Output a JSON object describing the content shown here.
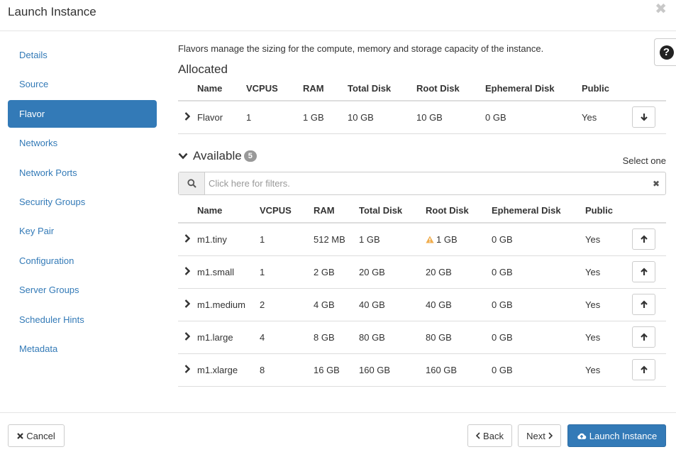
{
  "header": {
    "title": "Launch Instance",
    "close_icon": "close-icon"
  },
  "sidebar": {
    "items": [
      {
        "label": "Details",
        "active": false
      },
      {
        "label": "Source",
        "active": false
      },
      {
        "label": "Flavor",
        "active": true
      },
      {
        "label": "Networks",
        "active": false
      },
      {
        "label": "Network Ports",
        "active": false
      },
      {
        "label": "Security Groups",
        "active": false
      },
      {
        "label": "Key Pair",
        "active": false
      },
      {
        "label": "Configuration",
        "active": false
      },
      {
        "label": "Server Groups",
        "active": false
      },
      {
        "label": "Scheduler Hints",
        "active": false
      },
      {
        "label": "Metadata",
        "active": false
      }
    ]
  },
  "main": {
    "intro": "Flavors manage the sizing for the compute, memory and storage capacity of the instance.",
    "allocated": {
      "title": "Allocated",
      "columns": [
        "Name",
        "VCPUS",
        "RAM",
        "Total Disk",
        "Root Disk",
        "Ephemeral Disk",
        "Public"
      ],
      "rows": [
        {
          "name": "Flavor",
          "vcpus": "1",
          "ram": "1 GB",
          "total_disk": "10 GB",
          "root_disk": "10 GB",
          "ephemeral_disk": "0 GB",
          "public": "Yes"
        }
      ]
    },
    "available": {
      "title": "Available",
      "count": "5",
      "select_hint": "Select one",
      "filter_placeholder": "Click here for filters.",
      "columns": [
        "Name",
        "VCPUS",
        "RAM",
        "Total Disk",
        "Root Disk",
        "Ephemeral Disk",
        "Public"
      ],
      "rows": [
        {
          "name": "m1.tiny",
          "vcpus": "1",
          "ram": "512 MB",
          "total_disk": "1 GB",
          "root_disk": "1 GB",
          "root_warning": true,
          "ephemeral_disk": "0 GB",
          "public": "Yes"
        },
        {
          "name": "m1.small",
          "vcpus": "1",
          "ram": "2 GB",
          "total_disk": "20 GB",
          "root_disk": "20 GB",
          "root_warning": false,
          "ephemeral_disk": "0 GB",
          "public": "Yes"
        },
        {
          "name": "m1.medium",
          "vcpus": "2",
          "ram": "4 GB",
          "total_disk": "40 GB",
          "root_disk": "40 GB",
          "root_warning": false,
          "ephemeral_disk": "0 GB",
          "public": "Yes"
        },
        {
          "name": "m1.large",
          "vcpus": "4",
          "ram": "8 GB",
          "total_disk": "80 GB",
          "root_disk": "80 GB",
          "root_warning": false,
          "ephemeral_disk": "0 GB",
          "public": "Yes"
        },
        {
          "name": "m1.xlarge",
          "vcpus": "8",
          "ram": "16 GB",
          "total_disk": "160 GB",
          "root_disk": "160 GB",
          "root_warning": false,
          "ephemeral_disk": "0 GB",
          "public": "Yes"
        }
      ]
    }
  },
  "footer": {
    "cancel_label": "Cancel",
    "back_label": "Back",
    "next_label": "Next",
    "launch_label": "Launch Instance"
  },
  "colors": {
    "primary": "#337ab7",
    "warning": "#f0ad4e",
    "badge": "#999999"
  }
}
